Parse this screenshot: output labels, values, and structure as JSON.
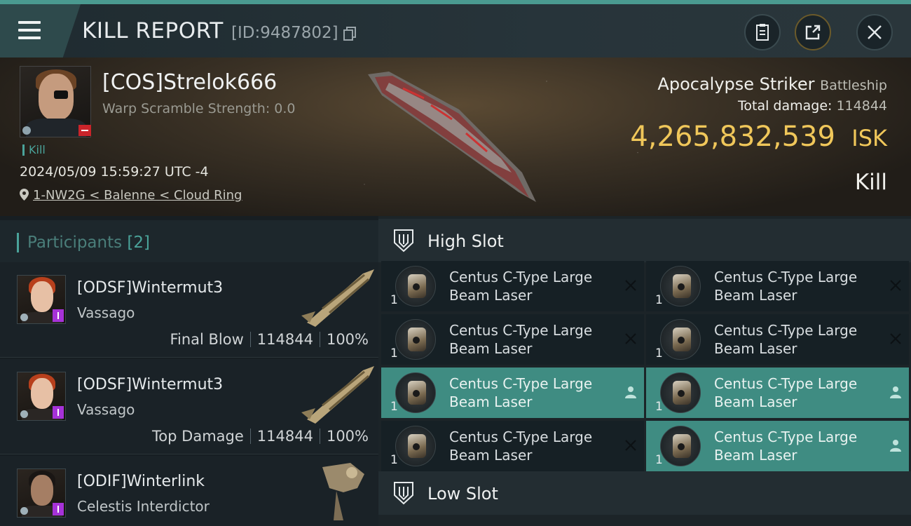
{
  "header": {
    "title": "KILL REPORT",
    "report_id": "[ID:9487802]"
  },
  "victim": {
    "name": "[COS]Strelok666",
    "warp_scramble": "Warp Scramble Strength: 0.0",
    "tag": "Kill",
    "datetime": "2024/05/09 15:59:27 UTC -4",
    "location": "1-NW2G < Balenne < Cloud Ring",
    "ship_name": "Apocalypse Striker",
    "ship_class": "Battleship",
    "total_damage_label": "Total damage:",
    "total_damage": "114844",
    "isk_value": "4,265,832,539",
    "isk_unit": "ISK",
    "result": "Kill"
  },
  "participants": {
    "title": "Participants",
    "count": "[2]",
    "rows": [
      {
        "name": "[ODSF]Wintermut3",
        "ship": "Vassago",
        "role": "Final Blow",
        "damage": "114844",
        "percent": "100%"
      },
      {
        "name": "[ODSF]Wintermut3",
        "ship": "Vassago",
        "role": "Top Damage",
        "damage": "114844",
        "percent": "100%"
      },
      {
        "name": "[ODIF]Winterlink",
        "ship": "Celestis Interdictor"
      }
    ]
  },
  "slots": {
    "high_title": "High Slot",
    "low_title": "Low Slot",
    "items": [
      {
        "line1": "Centus C-Type Large",
        "line2": "Beam Laser",
        "qty": "1",
        "state": "destroyed"
      },
      {
        "line1": "Centus C-Type Large",
        "line2": "Beam Laser",
        "qty": "1",
        "state": "destroyed"
      },
      {
        "line1": "Centus C-Type Large",
        "line2": "Beam Laser",
        "qty": "1",
        "state": "destroyed"
      },
      {
        "line1": "Centus C-Type Large",
        "line2": "Beam Laser",
        "qty": "1",
        "state": "destroyed"
      },
      {
        "line1": "Centus C-Type Large",
        "line2": "Beam Laser",
        "qty": "1",
        "state": "dropped"
      },
      {
        "line1": "Centus C-Type Large",
        "line2": "Beam Laser",
        "qty": "1",
        "state": "dropped"
      },
      {
        "line1": "Centus C-Type Large",
        "line2": "Beam Laser",
        "qty": "1",
        "state": "destroyed"
      },
      {
        "line1": "Centus C-Type Large",
        "line2": "Beam Laser",
        "qty": "1",
        "state": "dropped"
      }
    ]
  },
  "colors": {
    "accent": "#4aa39a",
    "isk": "#f0c75a",
    "dropped_bg": "#3f8c82",
    "loss_badge": "#c9242a"
  },
  "icons": [
    "menu-icon",
    "copy-icon",
    "clipboard-icon",
    "share-icon",
    "close-icon",
    "location-pin-icon",
    "high-slot-icon",
    "low-slot-icon",
    "destroyed-x-icon",
    "dropped-person-icon"
  ]
}
